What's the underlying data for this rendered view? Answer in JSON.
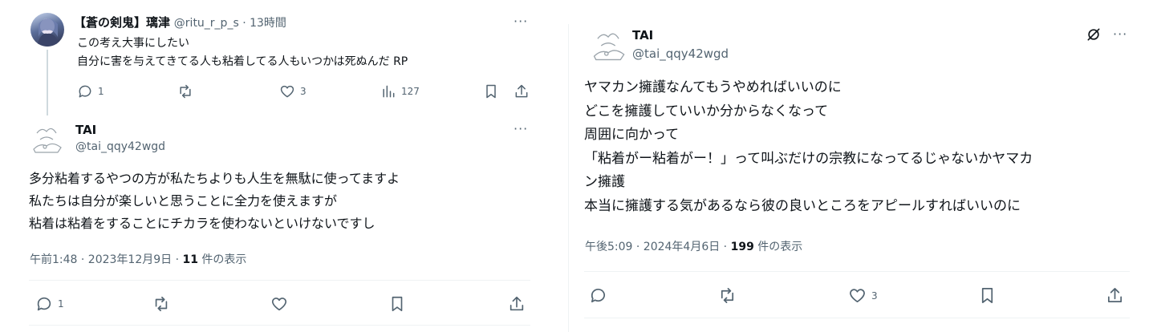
{
  "left": {
    "reply_tweet": {
      "display_name": "【蒼の剣鬼】璃津",
      "handle_time": "@ritu_r_p_s · 13時間",
      "lines": [
        "この考え大事にしたい",
        "自分に害を与えてきてる人も粘着してる人もいつかは死ぬんだ RP"
      ],
      "replies": "1",
      "likes": "3",
      "views": "127"
    },
    "main_tweet": {
      "display_name": "TAI",
      "handle": "@tai_qqy42wgd",
      "lines": [
        "多分粘着するやつの方が私たちよりも人生を無駄に使ってますよ",
        "私たちは自分が楽しいと思うことに全力を使えますが",
        "粘着は粘着をすることにチカラを使わないといけないですし"
      ],
      "time": "午前1:48 · 2023年12月9日 · ",
      "views": "11",
      "views_suffix": " 件の表示",
      "replies": "1"
    }
  },
  "right": {
    "tweet": {
      "display_name": "TAI",
      "handle": "@tai_qqy42wgd",
      "lines": [
        "ヤマカン擁護なんてもうやめればいいのに",
        "どこを擁護していいか分からなくなって",
        "周囲に向かって",
        "「粘着がー粘着がー！」って叫ぶだけの宗教になってるじゃないかヤマカ",
        "ン擁護",
        "本当に擁護する気があるなら彼の良いところをアピールすればいいのに"
      ],
      "time": "午後5:09 · 2024年4月6日 · ",
      "views": "199",
      "views_suffix": " 件の表示",
      "likes": "3"
    }
  },
  "colors": {
    "text": "#0f1419",
    "secondary": "#536471",
    "divider": "#eff3f4"
  }
}
